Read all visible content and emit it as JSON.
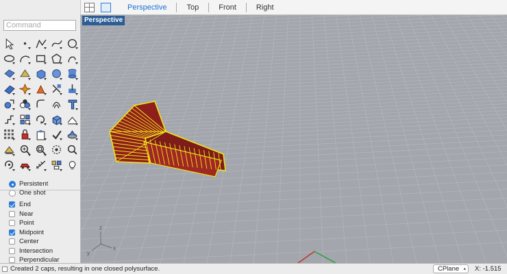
{
  "viewport_tabs": [
    "Perspective",
    "Top",
    "Front",
    "Right"
  ],
  "active_tab": "Perspective",
  "viewport_label": "Perspective",
  "command": {
    "placeholder": "Command",
    "value": ""
  },
  "toolbar_icons": [
    "select-arrow-icon",
    "point-icon",
    "polyline-icon",
    "curve-icon",
    "circle-icon",
    "ellipse-icon",
    "arc-icon",
    "rectangle-icon",
    "polygon-icon",
    "freeform-curve-icon",
    "surface-icon",
    "surface-edge-icon",
    "box-solid-icon",
    "sphere-icon",
    "cylinder-icon",
    "mesh-plane-icon",
    "explode-icon",
    "extrude-icon",
    "trim-icon",
    "split-icon",
    "move-icon",
    "boolean-icon",
    "fillet-icon",
    "offset-icon",
    "text-icon",
    "transform-icon",
    "array-icon",
    "rotate-icon",
    "solid-edit-icon",
    "dimension-icon",
    "grid-array-icon",
    "lock-icon",
    "clipboard-icon",
    "check-icon",
    "render-icon",
    "layer-icon",
    "zoom-in-icon",
    "zoom-window-icon",
    "pan-icon",
    "zoom-icon",
    "rotate-view-icon",
    "car-icon",
    "measure-icon",
    "properties-icon",
    "light-icon"
  ],
  "osnap": {
    "modes": [
      {
        "label": "Persistent",
        "selected": true
      },
      {
        "label": "One shot",
        "selected": false
      }
    ],
    "snaps": [
      {
        "label": "End",
        "checked": true
      },
      {
        "label": "Near",
        "checked": false
      },
      {
        "label": "Point",
        "checked": false
      },
      {
        "label": "Midpoint",
        "checked": true
      },
      {
        "label": "Center",
        "checked": false
      },
      {
        "label": "Intersection",
        "checked": false
      },
      {
        "label": "Perpendicular",
        "checked": false
      }
    ]
  },
  "axis_labels": {
    "z": "z",
    "x": "x",
    "y": "y"
  },
  "status": {
    "message": "Created 2 caps, resulting in one closed polysurface.",
    "cplane": "CPlane",
    "coordinate": "X: -1.515"
  },
  "colors": {
    "viewport_bg": "#a3a6ac",
    "grid_line": "#b4b7bc",
    "object_fill": "#8e1f1b",
    "wire_highlight": "#f2e21a",
    "active_tab": "#1a6fd6",
    "viewport_label_bg": "#2c5d94"
  }
}
